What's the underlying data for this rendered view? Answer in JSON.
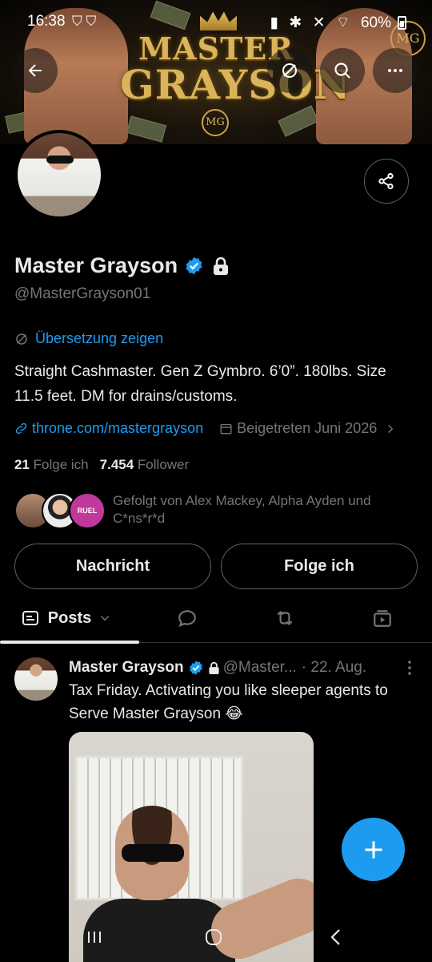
{
  "status_bar": {
    "time": "16:38",
    "notif_icons": [
      "shield-icon",
      "shield-icon"
    ],
    "sys_icons": [
      "bluetooth-icon",
      "mute-icon",
      "wifi-icon",
      "signal-icon"
    ],
    "battery": "60%"
  },
  "banner": {
    "logo_line1": "MASTER",
    "logo_line2": "GRAYSON",
    "monogram": "MG"
  },
  "profile": {
    "name": "Master Grayson",
    "handle": "@MasterGrayson01",
    "translate_label": "Übersetzung zeigen",
    "bio": "Straight Cashmaster. Gen Z Gymbro. 6’0”. 180lbs. Size 11.5 feet. DM for drains/customs.",
    "website": "throne.com/mastergrayson",
    "joined": "Beigetreten Juni 2026",
    "following_count": "21",
    "following_label": "Folge ich",
    "followers_count": "7.454",
    "followers_label": "Follower",
    "followed_by": "Gefolgt von Alex Mackey, Alpha Ayden und C*ns*r*d",
    "follower_badge_text": "RUEL"
  },
  "actions": {
    "message": "Nachricht",
    "follow": "Folge ich"
  },
  "tabs": {
    "posts": "Posts"
  },
  "tweet": {
    "name": "Master Grayson",
    "handle": "@Master...",
    "date": "· 22. Aug.",
    "text": "Tax Friday. Activating you like sleeper agents to Serve Master Grayson 😂"
  },
  "colors": {
    "accent": "#1d9bf0",
    "background": "#000000",
    "muted": "#71767b",
    "text": "#e7e9ea"
  }
}
